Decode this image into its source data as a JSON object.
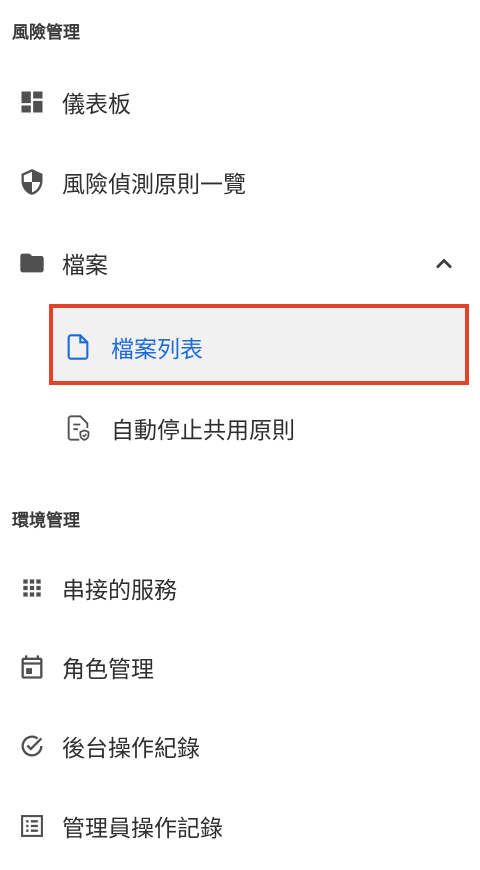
{
  "sections": {
    "risk": "風險管理",
    "env": "環境管理"
  },
  "items": {
    "dashboard": {
      "label": "儀表板",
      "icon": "dashboard-icon"
    },
    "detection_rules": {
      "label": "風險偵測原則一覽",
      "icon": "shield-icon"
    },
    "files": {
      "label": "檔案",
      "icon": "folder-icon",
      "expanded": true
    },
    "file_list": {
      "label": "檔案列表",
      "icon": "file-icon",
      "selected": true
    },
    "auto_stop": {
      "label": "自動停止共用原則",
      "icon": "file-shield-icon"
    },
    "connected_services": {
      "label": "串接的服務",
      "icon": "apps-grid-icon"
    },
    "role_mgmt": {
      "label": "角色管理",
      "icon": "calendar-icon"
    },
    "admin_log": {
      "label": "後台操作紀錄",
      "icon": "check-circle-icon"
    },
    "manager_log": {
      "label": "管理員操作記錄",
      "icon": "list-icon"
    }
  },
  "colors": {
    "selected_text": "#1f6bd6",
    "highlight_border": "#e0442a",
    "selected_bg": "#f1f1f1"
  }
}
